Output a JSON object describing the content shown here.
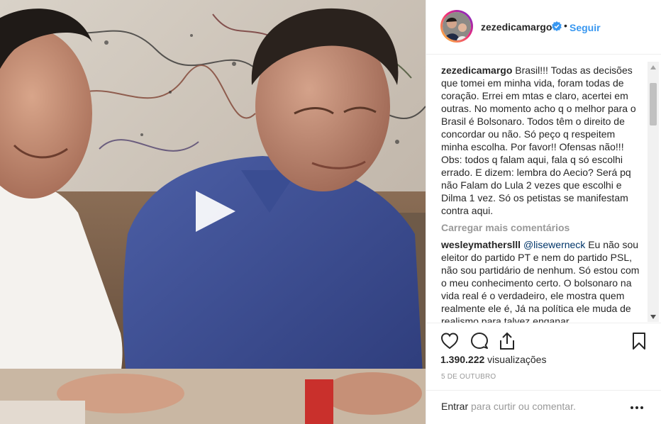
{
  "post": {
    "username": "zezedicamargo",
    "separator": "•",
    "follow_label": "Seguir",
    "caption_text": "Brasil!!! Todas as decisões que tomei em minha vida, foram todas de coração. Errei em mtas e claro, acertei em outras. No momento acho q o melhor para o Brasil é Bolsonaro. Todos têm o direito de concordar ou não. Só peço q respeitem minha escolha. Por favor!! Ofensas não!!! Obs: todos q falam aqui, fala q só escolhi errado. E dizem: lembra do Aecio? Será pq não Falam do Lula 2 vezes que escolhi e Dilma 1 vez. Só os petistas se manifestam contra aqui.",
    "load_more": "Carregar mais comentários",
    "comment": {
      "username": "wesleymatherslll",
      "mention": "@lisewerneck",
      "text": " Eu não sou eleitor do partido PT e nem do partido PSL, não sou partidário de nenhum. Só estou com o meu conhecimento certo. O bolsonaro na vida real é o verdadeiro, ele mostra quem realmente ele é, Já na política ele muda de realismo para talvez enganar"
    },
    "views_count": "1.390.222",
    "views_label": " visualizações",
    "date": "5 de outubro",
    "login_link": "Entrar",
    "login_suffix": " para curtir ou comentar."
  },
  "icons": {
    "play": "play-icon",
    "verified": "verified-badge-icon",
    "like": "heart-icon",
    "comment": "comment-bubble-icon",
    "share": "share-icon",
    "save": "bookmark-icon",
    "more": "more-options-icon"
  },
  "colors": {
    "link_blue": "#3897f0",
    "text": "#262626",
    "muted": "#999999",
    "border": "#efefef"
  }
}
